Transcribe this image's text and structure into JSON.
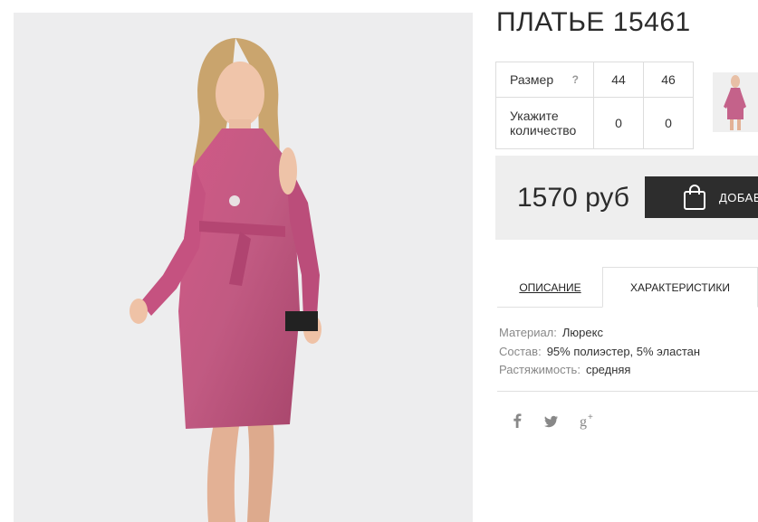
{
  "product": {
    "title": "ПЛАТЬЕ 15461",
    "photo_icon": "product-photo-woman-pink-dress",
    "thumbnail_icon": "product-thumbnail"
  },
  "size_table": {
    "size_label": "Размер",
    "help_mark": "?",
    "sizes": [
      "44",
      "46"
    ],
    "quantity_label_line1": "Укажите",
    "quantity_label_line2": "количество",
    "quantities": [
      "0",
      "0"
    ]
  },
  "purchase": {
    "price": "1570 руб",
    "add_button_label": "ДОБАВ",
    "bag_icon": "shopping-bag-icon"
  },
  "tabs": [
    {
      "label": "ОПИСАНИЕ",
      "active": false
    },
    {
      "label": "ХАРАКТЕРИСТИКИ",
      "active": true
    }
  ],
  "specs": [
    {
      "key": "Материал:",
      "value": "Люрекс"
    },
    {
      "key": "Состав:",
      "value": "95% полиэстер, 5% эластан"
    },
    {
      "key": "Растяжимость:",
      "value": "средняя"
    }
  ],
  "social": [
    "facebook-icon",
    "twitter-icon",
    "google-plus-icon"
  ],
  "colors": {
    "dress": "#c94f7c",
    "dark_button": "#2d2d2d",
    "price_box": "#eeeeee",
    "photo_bg": "#ededee"
  }
}
